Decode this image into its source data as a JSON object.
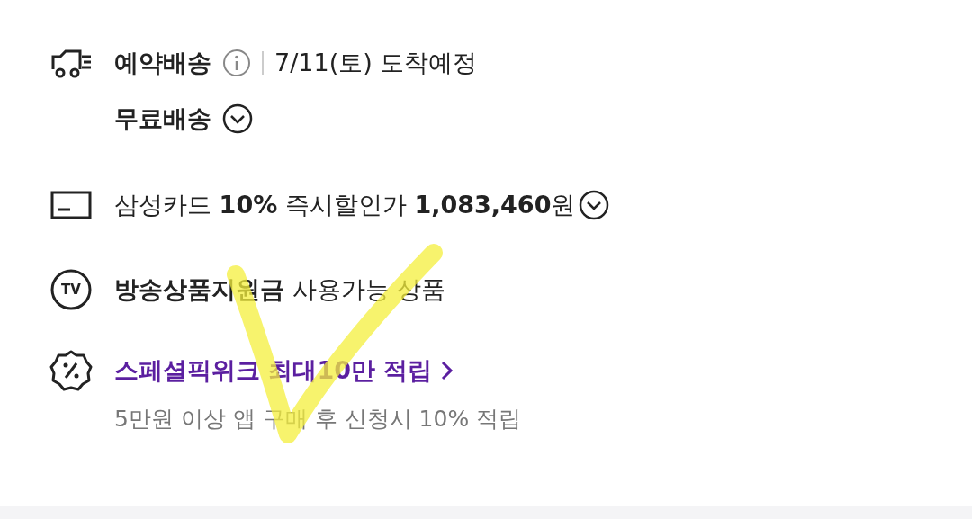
{
  "delivery": {
    "title": "예약배송",
    "date": "7/11(토) 도착예정",
    "fee": "무료배송"
  },
  "card_discount": {
    "text": "삼성카드 **10%** 즉시할인가 **1,083,460**원"
  },
  "broadcast": {
    "badge": "TV",
    "text": "**방송상품지원금** 사용가능 상품"
  },
  "promo": {
    "title": "스페셜픽위크 최대10만 적립",
    "subtitle": "5만원 이상 앱 구매 후 신청시 10% 적립"
  }
}
